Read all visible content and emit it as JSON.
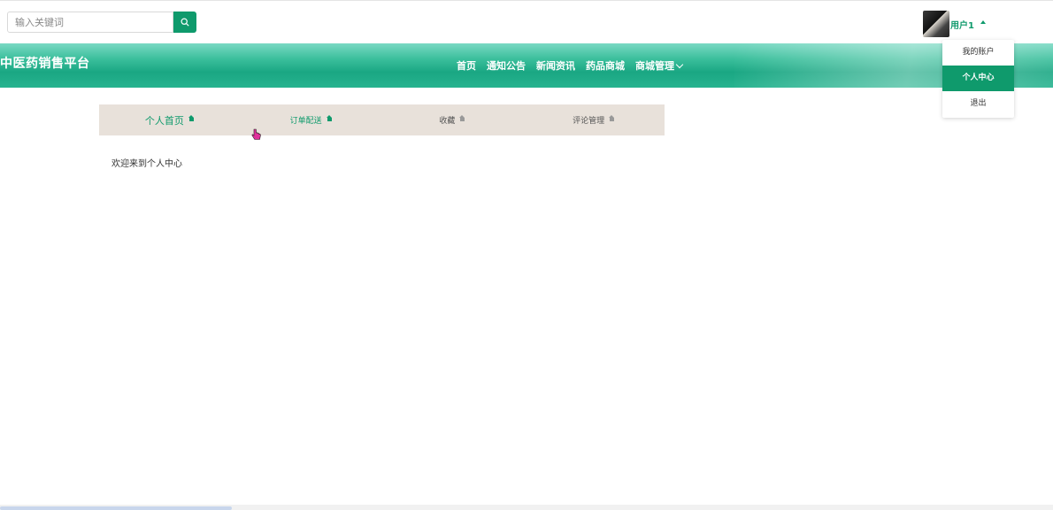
{
  "search": {
    "placeholder": "输入关键词"
  },
  "user": {
    "name": "用户1"
  },
  "brand": "中医药销售平台",
  "nav": {
    "items": [
      "首页",
      "通知公告",
      "新闻资讯",
      "药品商城",
      "商城管理"
    ]
  },
  "user_menu": {
    "items": [
      "我的账户",
      "个人中心",
      "退出"
    ],
    "active": "个人中心"
  },
  "tabs": [
    "个人首页",
    "订单配送",
    "收藏",
    "评论管理"
  ],
  "main": {
    "welcome": "欢迎来到个人中心"
  },
  "colors": {
    "accent": "#0f9a6c",
    "tab_bar": "#e8e1da",
    "header_teal": "#1aa783"
  },
  "icons": {
    "search": "search-icon",
    "tab": "home-icon",
    "nav_dropdown": "chevron-down-icon",
    "user_caret": "caret-up-icon"
  }
}
